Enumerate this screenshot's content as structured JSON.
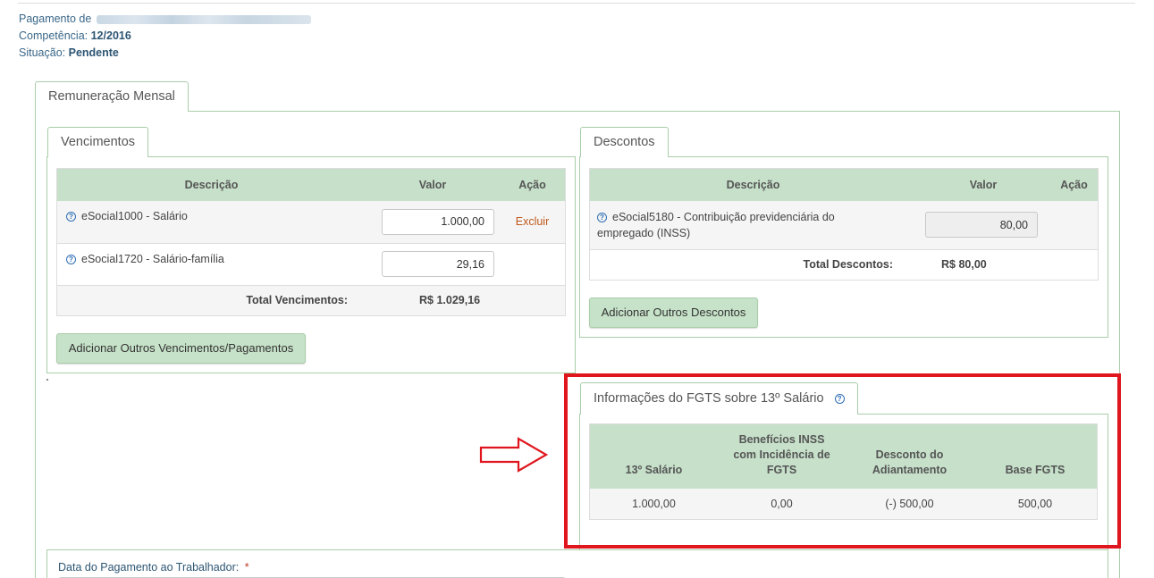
{
  "header": {
    "pagamento_label": "Pagamento de",
    "competencia_label": "Competência:",
    "competencia_value": "12/2016",
    "situacao_label": "Situação:",
    "situacao_value": "Pendente"
  },
  "main_tab": {
    "label": "Remuneração Mensal"
  },
  "vencimentos": {
    "tab_label": "Vencimentos",
    "columns": [
      "Descrição",
      "Valor",
      "Ação"
    ],
    "rows": [
      {
        "descricao": "eSocial1000 - Salário",
        "valor": "1.000,00",
        "acao": "Excluir"
      },
      {
        "descricao": "eSocial1720 - Salário-família",
        "valor": "29,16",
        "acao": ""
      }
    ],
    "total_label": "Total Vencimentos:",
    "total_value": "R$ 1.029,16",
    "add_button": "Adicionar Outros Vencimentos/Pagamentos"
  },
  "descontos": {
    "tab_label": "Descontos",
    "columns": [
      "Descrição",
      "Valor",
      "Ação"
    ],
    "rows": [
      {
        "descricao_line1": "eSocial5180 - Contribuição previdenciária do",
        "descricao_line2": "empregado (INSS)",
        "valor": "80,00"
      }
    ],
    "total_label": "Total Descontos:",
    "total_value": "R$ 80,00",
    "add_button": "Adicionar Outros Descontos"
  },
  "fgts": {
    "tab_label": "Informações do FGTS sobre 13º Salário",
    "columns": [
      "13º Salário",
      "Benefícios INSS com Incidência de FGTS",
      "Desconto do Adiantamento",
      "Base FGTS"
    ],
    "col2_lines": [
      "Benefícios INSS",
      "com Incidência de",
      "FGTS"
    ],
    "col3_lines": [
      "Desconto do",
      "Adiantamento"
    ],
    "row": [
      "1.000,00",
      "0,00",
      "(-) 500,00",
      "500,00"
    ]
  },
  "data_pagamento": {
    "label": "Data do Pagamento ao Trabalhador:",
    "required_mark": "*"
  },
  "colors": {
    "table_header_bg": "#c6e0c9",
    "panel_border": "#a9cda9",
    "highlight_red": "#e0161e",
    "link_orange": "#c0581b"
  }
}
